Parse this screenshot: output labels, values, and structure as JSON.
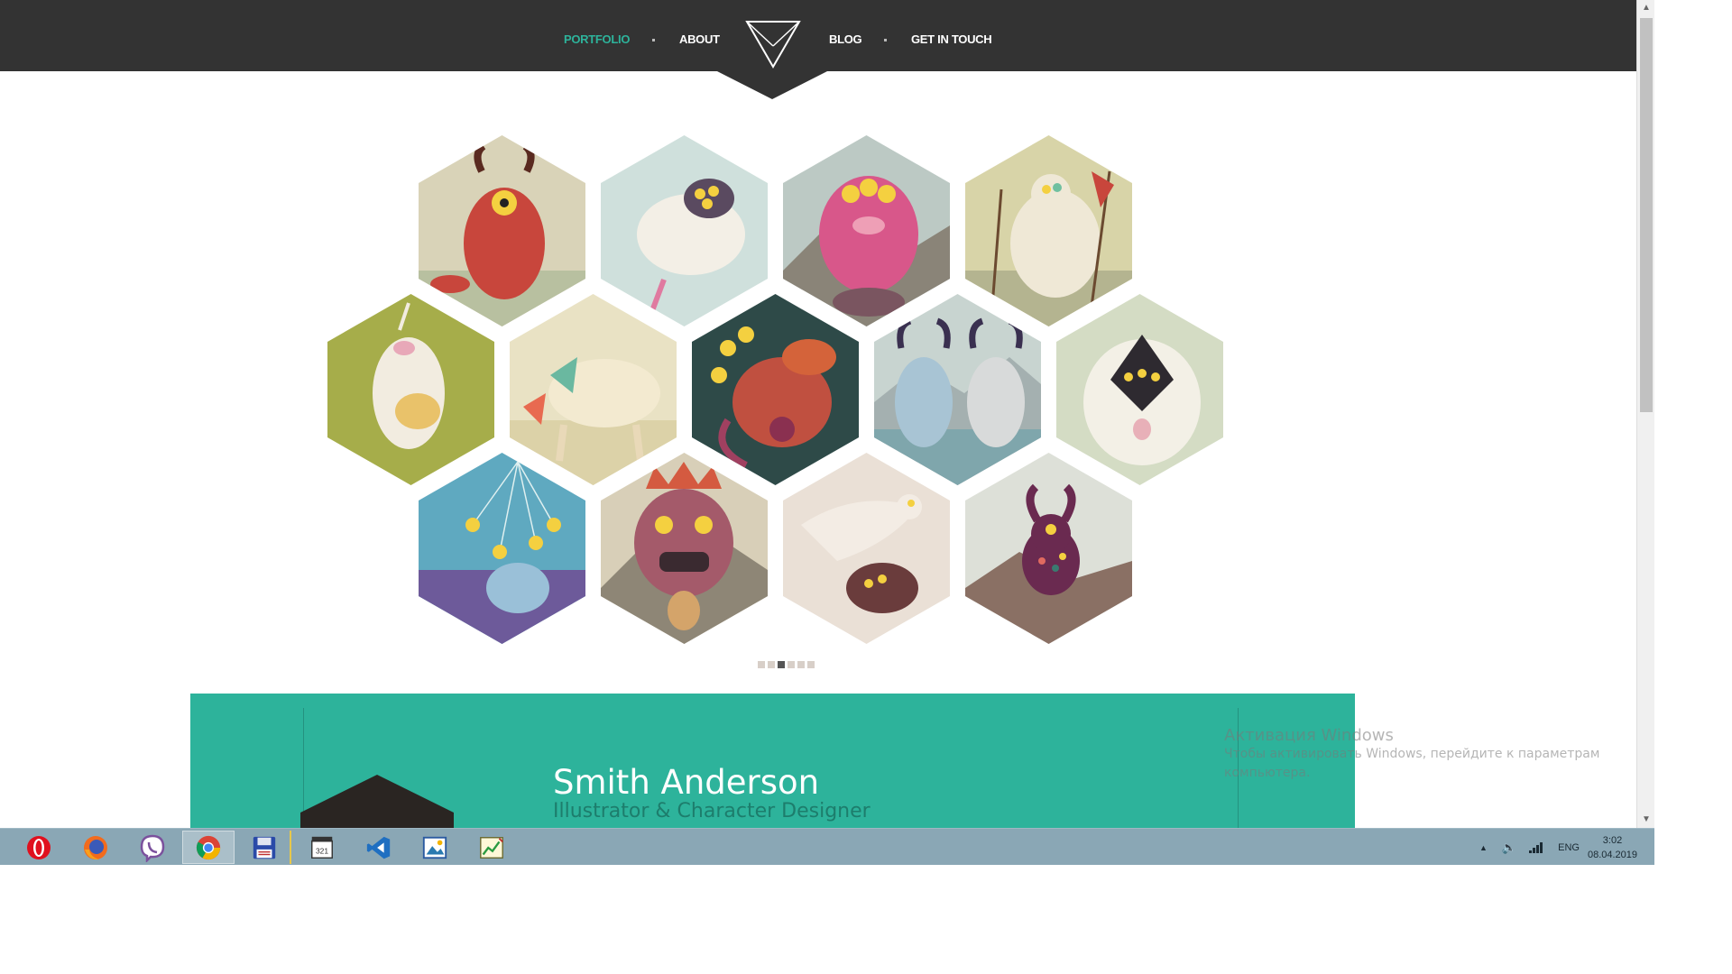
{
  "nav": {
    "items": [
      {
        "label": "PORTFOLIO",
        "active": true
      },
      {
        "label": "ABOUT",
        "active": false
      },
      {
        "label": "BLOG",
        "active": false
      },
      {
        "label": "GET IN TOUCH",
        "active": false
      }
    ],
    "active_color": "#2db39b",
    "bar_color": "#333333"
  },
  "gallery": {
    "items": [
      {
        "name": "red-horned-monster"
      },
      {
        "name": "sheep-monster"
      },
      {
        "name": "pink-multi-eyed-monster"
      },
      {
        "name": "white-masked-creature"
      },
      {
        "name": "sleeping-unicorn-pig"
      },
      {
        "name": "pig-creature-field"
      },
      {
        "name": "octopus-eyes-monster"
      },
      {
        "name": "two-yeti-monsters"
      },
      {
        "name": "white-yeti-three-eyes"
      },
      {
        "name": "jellyfish-blue"
      },
      {
        "name": "tribal-mask-monster"
      },
      {
        "name": "winged-creature"
      },
      {
        "name": "purple-horned-creature"
      }
    ],
    "slider_dots": 6,
    "slider_active_index": 2
  },
  "profile": {
    "name": "Smith Anderson",
    "role": "Illustrator & Character Designer",
    "band_color": "#2db39b"
  },
  "watermark": {
    "title": "Активация Windows",
    "body": "Чтобы активировать Windows, перейдите к параметрам компьютера."
  },
  "taskbar": {
    "apps": [
      {
        "name": "opera-icon"
      },
      {
        "name": "firefox-icon"
      },
      {
        "name": "viber-icon"
      },
      {
        "name": "chrome-icon",
        "active": true
      },
      {
        "name": "save-disk-icon"
      },
      {
        "name": "media-player-classic-icon"
      },
      {
        "name": "vscode-icon"
      },
      {
        "name": "photo-viewer-icon"
      },
      {
        "name": "chart-editor-icon"
      }
    ],
    "language": "ENG",
    "time": "3:02",
    "date": "08.04.2019"
  }
}
